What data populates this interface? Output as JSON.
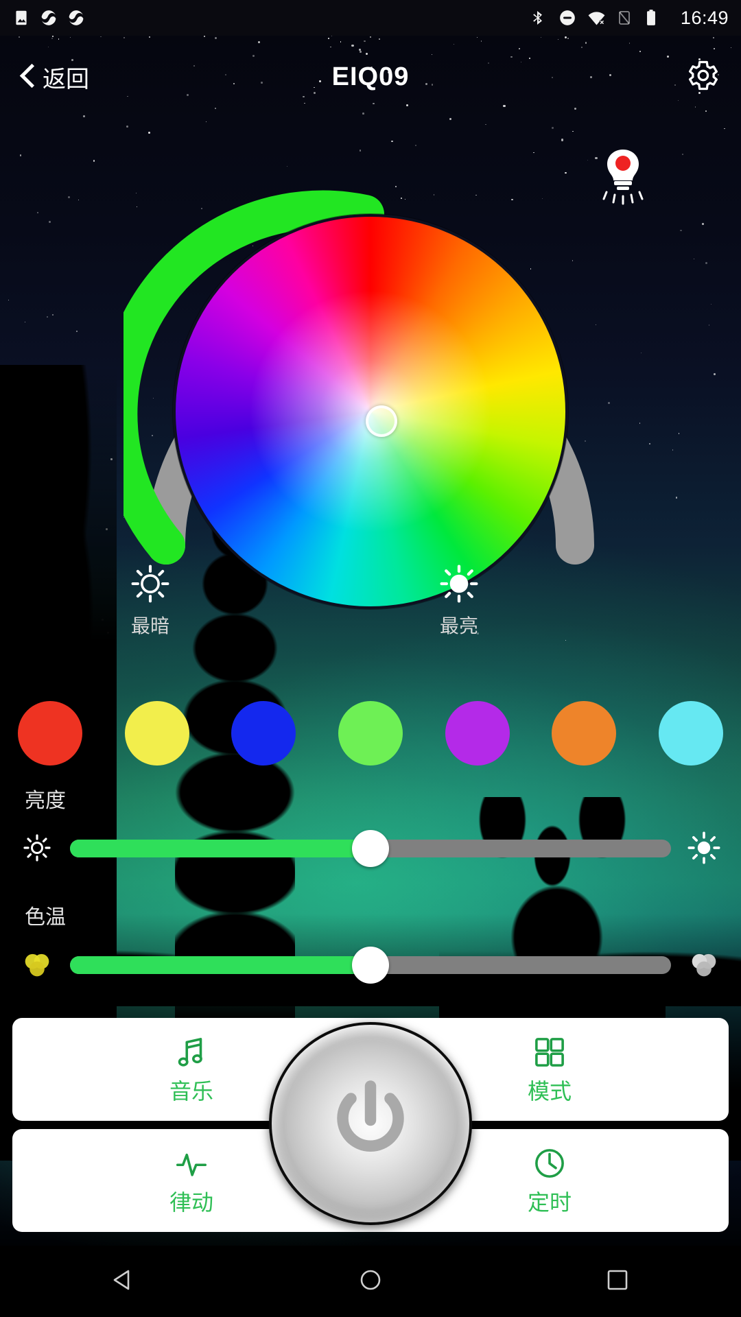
{
  "statusbar": {
    "time": "16:49",
    "left_icons": [
      "image-icon",
      "sync-icon",
      "sync-icon"
    ],
    "right_icons": [
      "bluetooth-icon",
      "do-not-disturb-icon",
      "wifi-off-icon",
      "sim-off-icon",
      "battery-icon"
    ]
  },
  "header": {
    "back_label": "返回",
    "title": "EIQ09",
    "settings_icon": "gear-icon",
    "back_icon": "chevron-left-icon"
  },
  "device": {
    "bulb_icon": "bulb-indicator-icon",
    "bulb_status_color": "#ee2222"
  },
  "color_wheel": {
    "arc_track_color": "#9b9b9b",
    "arc_fill_color": "#22e622",
    "arc_value_percent": 55,
    "handle_position": "center",
    "dim_marker": {
      "icon": "sun-outline-icon",
      "label": "最暗"
    },
    "bright_marker": {
      "icon": "sun-filled-icon",
      "label": "最亮"
    }
  },
  "presets": [
    {
      "name": "preset-red",
      "color": "#ee3322"
    },
    {
      "name": "preset-yellow",
      "color": "#f2ee4c"
    },
    {
      "name": "preset-blue",
      "color": "#1428ee"
    },
    {
      "name": "preset-green",
      "color": "#6ef055"
    },
    {
      "name": "preset-purple",
      "color": "#b42ae8"
    },
    {
      "name": "preset-orange",
      "color": "#ee842a"
    },
    {
      "name": "preset-cyan",
      "color": "#66e8f2"
    }
  ],
  "sliders": [
    {
      "name": "brightness",
      "label": "亮度",
      "value_percent": 50,
      "left_icon": "sun-small-icon",
      "right_icon": "sun-large-icon",
      "fill_color": "#2fdf5a",
      "track_color": "#808080"
    },
    {
      "name": "color-temperature",
      "label": "色温",
      "value_percent": 50,
      "left_icon": "warm-color-icon",
      "right_icon": "cool-color-icon",
      "fill_color": "#2fdf5a",
      "track_color": "#808080"
    }
  ],
  "bottom_buttons": [
    {
      "name": "music",
      "label": "音乐",
      "icon": "music-note-icon"
    },
    {
      "name": "mode",
      "label": "模式",
      "icon": "grid-icon"
    },
    {
      "name": "rhythm",
      "label": "律动",
      "icon": "waveform-icon"
    },
    {
      "name": "timer",
      "label": "定时",
      "icon": "clock-icon"
    }
  ],
  "power_button": {
    "name": "power",
    "icon": "power-icon"
  },
  "navbar": {
    "back": "triangle-back-icon",
    "home": "circle-home-icon",
    "recents": "square-recents-icon"
  },
  "accent": {
    "green": "#2fbf55",
    "arc_green": "#22e622"
  }
}
